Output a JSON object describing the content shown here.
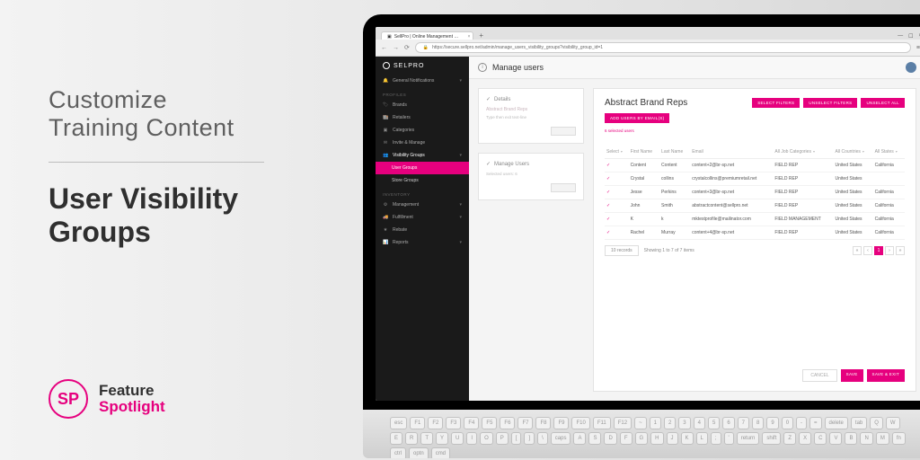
{
  "promo": {
    "line1": "Customize",
    "line2": "Training Content",
    "big1": "User Visibility",
    "big2": "Groups"
  },
  "feature_badge": {
    "initials": "SP",
    "line1": "Feature",
    "line2": "Spotlight"
  },
  "browser": {
    "tab_title": "SellPro | Online Management …",
    "url": "https://secure.sellpro.net/admin/manage_users_visibility_groups?visibility_group_id=1",
    "lock": "🔒"
  },
  "brand": "SELPRO",
  "sidebar": {
    "notifications": "General Notifications",
    "section_profiles": "PROFILES",
    "items_profiles": [
      "Brands",
      "Retailers",
      "Categories",
      "Invite & Manage",
      "Visibility Groups"
    ],
    "sub_items": [
      "User Groups",
      "Store Groups"
    ],
    "section_inventory": "INVENTORY",
    "items_inventory": [
      "Management",
      "Fulfillment",
      "Rebate",
      "Reports"
    ]
  },
  "page_title": "Manage users",
  "left_cards": {
    "details_title": "Details",
    "details_name": "Abstract Brand Reps",
    "details_hint": "Type then exit text-line",
    "manage_title": "Manage Users",
    "selected_users_label": "Selected users:",
    "selected_users_count": "6"
  },
  "panel": {
    "title": "Abstract Brand Reps",
    "add_btn": "ADD USERS BY EMAIL(S)",
    "select_filters": "SELECT FILTERS",
    "unselect_filters": "UNSELECT FILTERS",
    "unselect_all": "UNSELECT ALL",
    "selected_count_text": "6 selected users"
  },
  "columns": [
    "Select",
    "First Name",
    "Last Name",
    "Email",
    "All Job Categories",
    "All Countries",
    "All States"
  ],
  "rows": [
    {
      "first": "Content",
      "last": "Content",
      "email": "content+2@br-sp.net",
      "job": "FIELD REP",
      "country": "United States",
      "state": "California"
    },
    {
      "first": "Crystal",
      "last": "collins",
      "email": "crystalcollins@premiumretail.net",
      "job": "FIELD REP",
      "country": "United States",
      "state": ""
    },
    {
      "first": "Jesse",
      "last": "Perkins",
      "email": "content+3@br-sp.net",
      "job": "FIELD REP",
      "country": "United States",
      "state": "California"
    },
    {
      "first": "John",
      "last": "Smith",
      "email": "abstractcontent@sellpro.net",
      "job": "FIELD REP",
      "country": "United States",
      "state": "California"
    },
    {
      "first": "K",
      "last": "k",
      "email": "mktestprofile@mailinator.com",
      "job": "FIELD MANAGEMENT",
      "country": "United States",
      "state": "California"
    },
    {
      "first": "Rachel",
      "last": "Murray",
      "email": "content+4@br-sp.net",
      "job": "FIELD REP",
      "country": "United States",
      "state": "California"
    }
  ],
  "pager": {
    "page_size": "10 records",
    "summary": "Showing 1 to 7 of 7 items",
    "current": "1"
  },
  "footer": {
    "cancel": "CANCEL",
    "save": "SAVE",
    "save_exit": "SAVE & EXIT"
  },
  "keys": [
    "esc",
    "F1",
    "F2",
    "F3",
    "F4",
    "F5",
    "F6",
    "F7",
    "F8",
    "F9",
    "F10",
    "F11",
    "F12",
    "~",
    "1",
    "2",
    "3",
    "4",
    "5",
    "6",
    "7",
    "8",
    "9",
    "0",
    "-",
    "=",
    "delete",
    "tab",
    "Q",
    "W",
    "E",
    "R",
    "T",
    "Y",
    "U",
    "I",
    "O",
    "P",
    "[",
    "]",
    "\\",
    "caps",
    "A",
    "S",
    "D",
    "F",
    "G",
    "H",
    "J",
    "K",
    "L",
    ";",
    "'",
    "return",
    "shift",
    "Z",
    "X",
    "C",
    "V",
    "B",
    "N",
    "M",
    "fn",
    "ctrl",
    "optn",
    "cmd"
  ]
}
